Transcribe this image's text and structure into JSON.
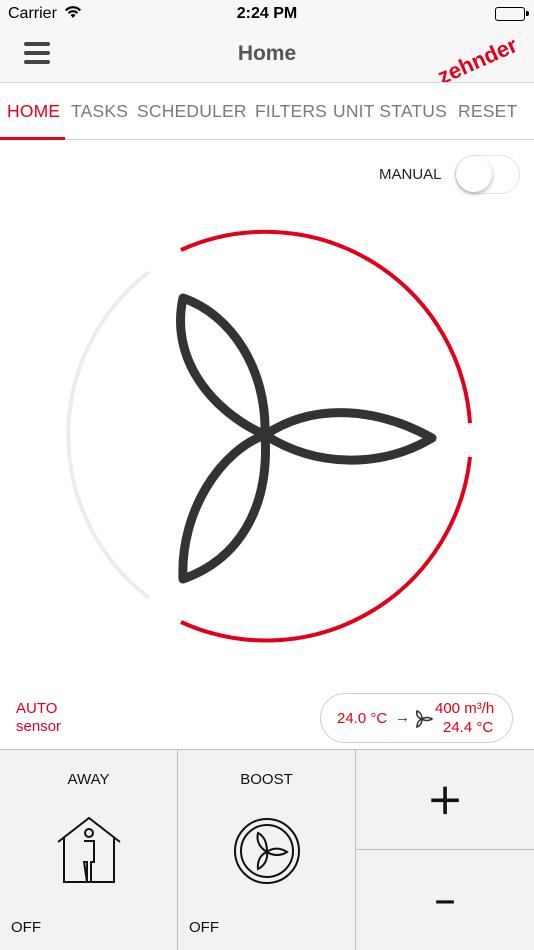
{
  "status_bar": {
    "carrier": "Carrier",
    "time": "2:24 PM",
    "wifi_icon": "wifi-icon",
    "battery_icon": "battery-icon"
  },
  "nav": {
    "title": "Home",
    "menu_icon": "hamburger-menu-icon",
    "logo_text": "zehnder"
  },
  "tabs": [
    {
      "label": "HOME",
      "active": true
    },
    {
      "label": "TASKS",
      "active": false
    },
    {
      "label": "SCHEDULER",
      "active": false
    },
    {
      "label": "FILTERS",
      "active": false
    },
    {
      "label": "UNIT STATUS",
      "active": false
    },
    {
      "label": "RESET",
      "active": false
    }
  ],
  "manual": {
    "label": "MANUAL",
    "enabled": false
  },
  "fan": {
    "icon": "fan-icon"
  },
  "mode": {
    "line1": "AUTO",
    "line2": "sensor"
  },
  "climate": {
    "inlet_temp": "24.0 °C",
    "arrow": "→",
    "airflow": "400 m³/h",
    "outlet_temp": "24.4 °C"
  },
  "controls": {
    "away": {
      "label": "AWAY",
      "state": "OFF",
      "icon": "house-person-icon"
    },
    "boost": {
      "label": "BOOST",
      "state": "OFF",
      "icon": "boost-fan-icon"
    },
    "plus": {
      "label": "+"
    },
    "minus": {
      "label": "–"
    }
  },
  "colors": {
    "accent": "#e2001a",
    "text_gray": "#7a7a7a",
    "panel": "#f2f2f2"
  }
}
